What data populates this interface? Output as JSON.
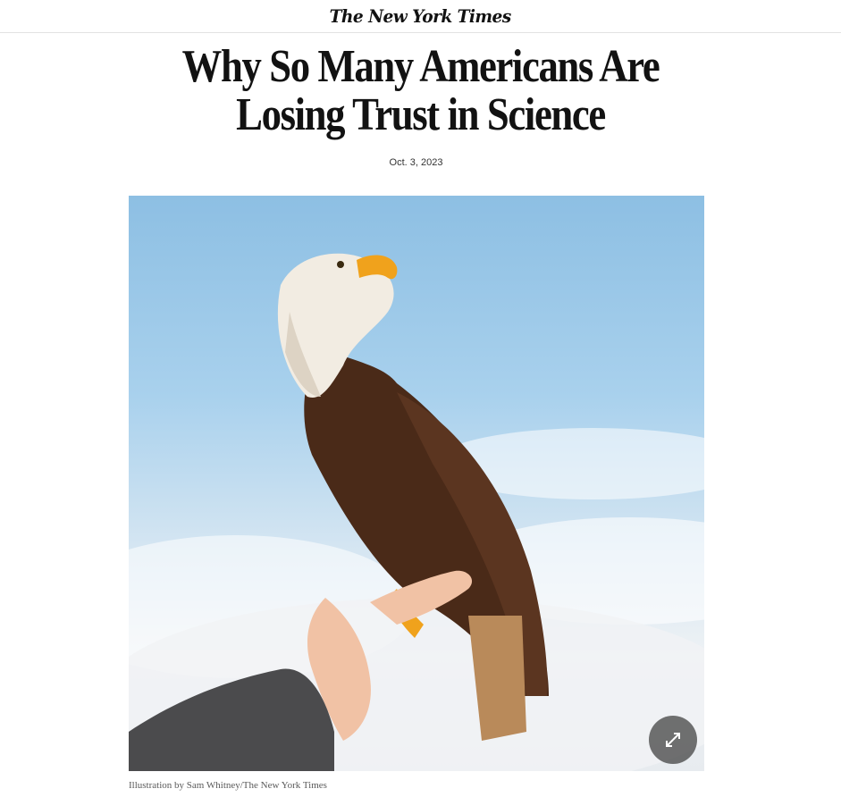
{
  "masthead": {
    "logo_text": "The New York Times"
  },
  "article": {
    "headline": "Why So Many Americans Are Losing Trust in Science",
    "date": "Oct. 3, 2023",
    "image_caption": "Illustration by Sam Whitney/The New York Times"
  },
  "icons": {
    "expand": "expand-arrows-icon"
  },
  "colors": {
    "sky": "#9ccbea",
    "eagle_body": "#4a2a18",
    "beak": "#f0a21c",
    "button_bg": "#3c3c3c"
  }
}
